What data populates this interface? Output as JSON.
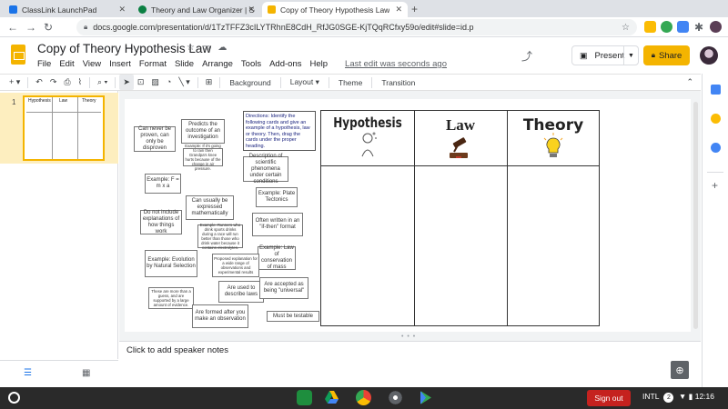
{
  "browser": {
    "tabs": [
      {
        "label": "ClassLink LaunchPad",
        "active": false
      },
      {
        "label": "Theory and Law Organizer | Sch",
        "active": false
      },
      {
        "label": "Copy of Theory Hypothesis Law",
        "active": true
      }
    ],
    "url": "docs.google.com/presentation/d/1TzTFFZ3cILYTRhnE8CdH_RfJG0SGE-KjTQqRCfxy59o/edit#slide=id.p"
  },
  "doc": {
    "title": "Copy of Theory Hypothesis Law",
    "menus": [
      "File",
      "Edit",
      "View",
      "Insert",
      "Format",
      "Slide",
      "Arrange",
      "Tools",
      "Add-ons",
      "Help"
    ],
    "last_edit": "Last edit was seconds ago",
    "present_label": "Present",
    "share_label": "Share"
  },
  "toolbar": {
    "background": "Background",
    "layout": "Layout",
    "theme": "Theme",
    "transition": "Transition"
  },
  "filmstrip": {
    "slide_number": "1",
    "thumb_headers": [
      "Hypothesis",
      "Law",
      "Theory"
    ]
  },
  "slide": {
    "directions": "Directions: Identify the following cards and give an example of a hypothesis, law or theory. Then, drag the cards under the proper heading.",
    "columns": [
      "Hypothesis",
      "Law",
      "Theory"
    ],
    "cards": [
      "Can never be proven, can only be disproven",
      "Predicts the outcome of an investigation",
      "Example: If it's going to rain then Grandpa's knee hurts because of the change in air pressure.",
      "Description of scientific phenomena under certain conditions",
      "Example: F = m x a",
      "Can usually be expressed mathematically",
      "Example: Plate Tectonics",
      "Do not include explanations of how things work",
      "Example: Runners who drink sports drinks during a race will run better than those who drink water because it contains electrolytes.",
      "Often written in an \"if-then\" format",
      "Example: Evolution by Natural Selection",
      "Example: Law of conservation of mass",
      "Proposed explanation for a wide range of observations and experimental results",
      "These are more than a guess, and are supported by a large amount of evidence.",
      "Are used to describe laws",
      "Are accepted as being \"universal\"",
      "Are formed after you make an observation",
      "Must be testable"
    ]
  },
  "notes": {
    "placeholder": "Click to add speaker notes"
  },
  "shelf": {
    "sign_out": "Sign out",
    "ime": "INTL",
    "notif_count": "2",
    "time": "12:16"
  },
  "colors": {
    "slides_yellow": "#f4b400",
    "sign_out_red": "#c5221f"
  }
}
